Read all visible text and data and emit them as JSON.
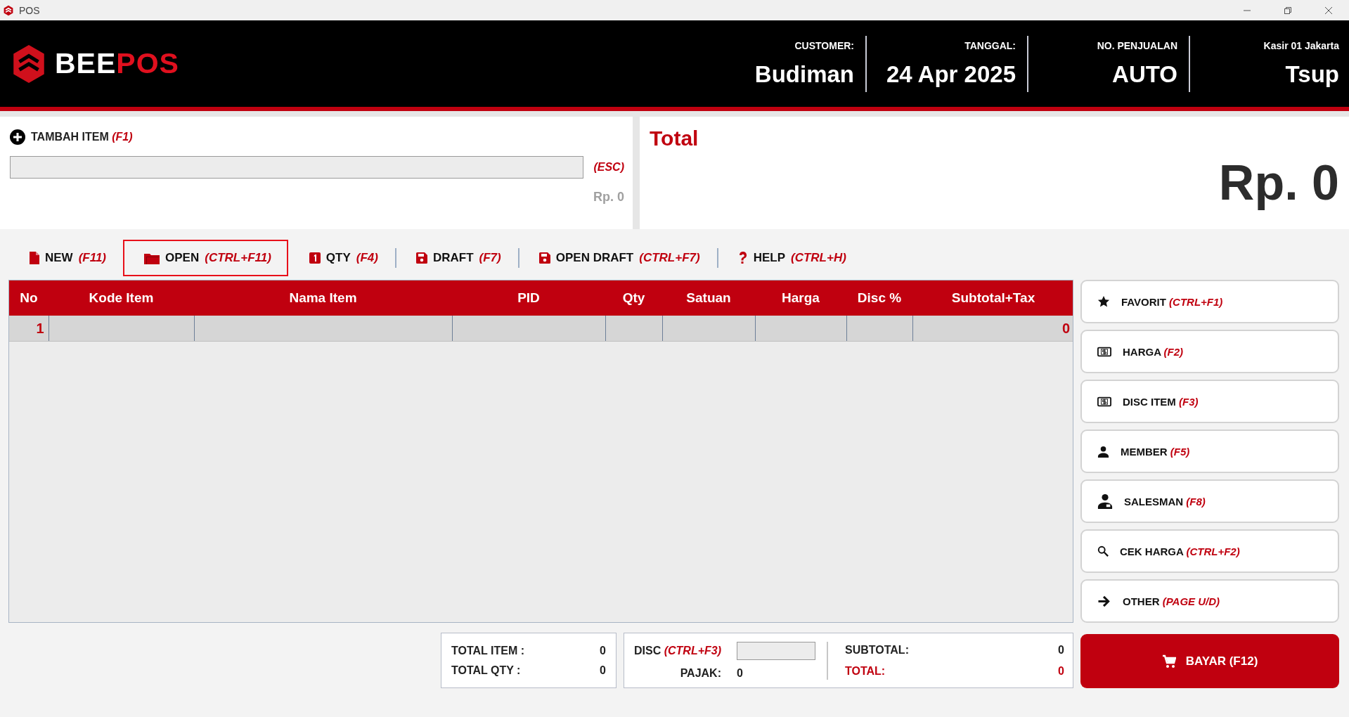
{
  "window": {
    "title": "POS"
  },
  "brand": {
    "name": "BEE",
    "accent": "POS"
  },
  "header_fields": [
    {
      "label": "CUSTOMER:",
      "value": "Budiman"
    },
    {
      "label": "TANGGAL:",
      "value": "24 Apr 2025"
    },
    {
      "label": "NO. PENJUALAN",
      "value": "AUTO"
    },
    {
      "label": "Kasir 01 Jakarta",
      "value": "Tsup"
    }
  ],
  "add_item": {
    "label": "TAMBAH ITEM",
    "shortcut": "(F1)",
    "clear_shortcut": "(ESC)",
    "price": "Rp. 0"
  },
  "total_panel": {
    "title": "Total",
    "amount": "Rp. 0"
  },
  "toolbar": [
    {
      "kind": "file",
      "label": "NEW",
      "shortcut": "(F11)",
      "selected": false
    },
    {
      "kind": "folder",
      "label": "OPEN",
      "shortcut": "(CTRL+F11)",
      "selected": true
    },
    {
      "kind": "number",
      "label": "QTY",
      "shortcut": "(F4)",
      "selected": false
    },
    {
      "kind": "save",
      "label": "DRAFT",
      "shortcut": "(F7)",
      "selected": false
    },
    {
      "kind": "save",
      "label": "OPEN DRAFT",
      "shortcut": "(CTRL+F7)",
      "selected": false
    },
    {
      "kind": "help",
      "label": "HELP",
      "shortcut": "(CTRL+H)",
      "selected": false
    }
  ],
  "table": {
    "columns": [
      "No",
      "Kode Item",
      "Nama Item",
      "PID",
      "Qty",
      "Satuan",
      "Harga",
      "Disc %",
      "Subtotal+Tax"
    ],
    "rows": [
      {
        "no": "1",
        "subtotal_tax": "0",
        "selected": true
      }
    ]
  },
  "side_buttons": [
    {
      "kind": "star",
      "label": "FAVORIT",
      "shortcut": "(CTRL+F1)"
    },
    {
      "kind": "money",
      "label": "HARGA",
      "shortcut": "(F2)"
    },
    {
      "kind": "money",
      "label": "DISC ITEM",
      "shortcut": "(F3)"
    },
    {
      "kind": "person",
      "label": "MEMBER",
      "shortcut": "(F5)"
    },
    {
      "kind": "badge-person",
      "label": "SALESMAN",
      "shortcut": "(F8)"
    },
    {
      "kind": "search",
      "label": "CEK HARGA",
      "shortcut": "(CTRL+F2)"
    },
    {
      "kind": "arrow",
      "label": "OTHER",
      "shortcut": "(PAGE U/D)"
    }
  ],
  "summary": {
    "counts": [
      {
        "label": "TOTAL ITEM :",
        "value": "0"
      },
      {
        "label": "TOTAL QTY :",
        "value": "0"
      }
    ],
    "discount": {
      "label": "DISC",
      "shortcut": "(CTRL+F3)"
    },
    "tax": {
      "label": "PAJAK:",
      "value": "0"
    },
    "totals": [
      {
        "label": "SUBTOTAL:",
        "value": "0",
        "highlight": false
      },
      {
        "label": "TOTAL:",
        "value": "0",
        "highlight": true
      }
    ]
  },
  "pay_button": {
    "label": "BAYAR (F12)"
  }
}
